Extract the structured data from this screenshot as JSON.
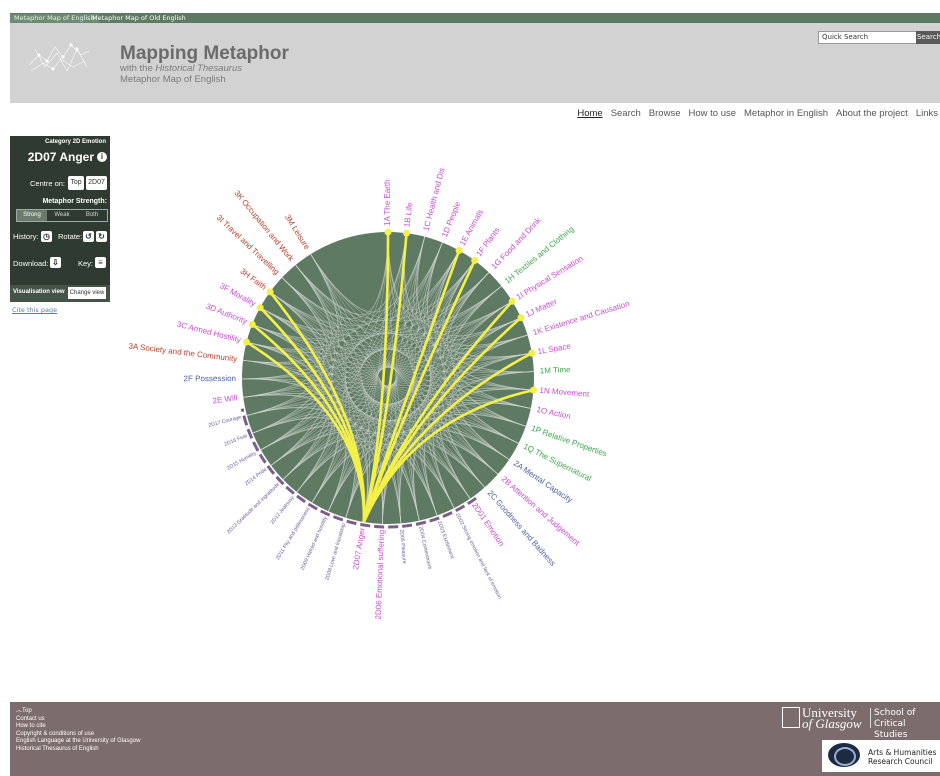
{
  "tabs": [
    "Metaphor Map of English",
    "Metaphor Map of Old English"
  ],
  "header": {
    "title": "Mapping Metaphor",
    "sub_prefix": "with the ",
    "sub_italic": "Historical Thesaurus",
    "sub2": "Metaphor Map of English",
    "search_placeholder": "Quick Search",
    "search_button": "Search"
  },
  "nav": [
    "Home",
    "Search",
    "Browse",
    "How to use",
    "Metaphor in English",
    "About the project",
    "Links"
  ],
  "panel": {
    "category": "Category 2D Emotion",
    "current": "2D07 Anger",
    "centre_on": "Centre on:",
    "centre_top": "Top",
    "centre_code": "2D07",
    "strength_label": "Metaphor Strength:",
    "strength_options": [
      "Strong",
      "Weak",
      "Both"
    ],
    "strength_selected": "Strong",
    "history": "History:",
    "rotate": "Rotate:",
    "download": "Download:",
    "key": "Key:",
    "vis_view": "Visualisation view",
    "change_view": "Change view"
  },
  "cite": "Cite this page",
  "colors": {
    "disc": "#5f7a63",
    "highlight": "#f4f04a",
    "magenta": "#c94bd1",
    "green": "#3ea84e",
    "red": "#b8402d",
    "purple": "#6b5a9c",
    "blue": "#4d62a8"
  },
  "viz": {
    "center_code": "2D07",
    "labels": [
      {
        "t": "1A The Earth",
        "c": "magenta",
        "yellow": true
      },
      {
        "t": "1B Life",
        "c": "magenta",
        "yellow": true
      },
      {
        "t": "1C Health and Dis",
        "c": "magenta",
        "yellow": false
      },
      {
        "t": "1D People",
        "c": "magenta",
        "yellow": false
      },
      {
        "t": "1E Animals",
        "c": "magenta",
        "yellow": true
      },
      {
        "t": "1F Plants",
        "c": "magenta",
        "yellow": true
      },
      {
        "t": "1G Food and Drink",
        "c": "magenta",
        "yellow": false
      },
      {
        "t": "1H Textiles and Clothing",
        "c": "green",
        "yellow": false
      },
      {
        "t": "1I Physical Sensation",
        "c": "magenta",
        "yellow": true
      },
      {
        "t": "1J Matter",
        "c": "magenta",
        "yellow": true
      },
      {
        "t": "1K Existence and Causation",
        "c": "magenta",
        "yellow": false
      },
      {
        "t": "1L Space",
        "c": "magenta",
        "yellow": true
      },
      {
        "t": "1M Time",
        "c": "green",
        "yellow": false
      },
      {
        "t": "1N Movement",
        "c": "magenta",
        "yellow": true
      },
      {
        "t": "1O Action",
        "c": "magenta",
        "yellow": false
      },
      {
        "t": "1P Relative Properties",
        "c": "green",
        "yellow": false
      },
      {
        "t": "1Q The Supernatural",
        "c": "green",
        "yellow": false
      },
      {
        "t": "2A Mental Capacity",
        "c": "blue",
        "yellow": false
      },
      {
        "t": "2B Attention and Judgement",
        "c": "magenta",
        "yellow": false
      },
      {
        "t": "2C Goodness and Badness",
        "c": "blue",
        "yellow": false
      },
      {
        "t": "2D01 Emotion",
        "c": "magenta",
        "yellow": false
      },
      {
        "t": "2D02 Strong emotion and lack of emotion",
        "c": "purple",
        "yellow": false
      },
      {
        "t": "2D03 Excitement",
        "c": "purple",
        "yellow": false
      },
      {
        "t": "2D04 Contentment",
        "c": "purple",
        "yellow": false
      },
      {
        "t": "2D05 Pleasure",
        "c": "purple",
        "yellow": false
      },
      {
        "t": "2D06 Emotional suffering",
        "c": "magenta",
        "yellow": false
      },
      {
        "t": "2D07 Anger",
        "c": "magenta",
        "yellow": false
      },
      {
        "t": "2D08 Love and friendship",
        "c": "purple",
        "yellow": false
      },
      {
        "t": "2D09 Hatred and hostility",
        "c": "purple",
        "yellow": false
      },
      {
        "t": "2D11 Pity and pitilessness",
        "c": "purple",
        "yellow": false
      },
      {
        "t": "2D12 Jealousy",
        "c": "purple",
        "yellow": false
      },
      {
        "t": "2D13 Gratitude and ingratitude",
        "c": "purple",
        "yellow": false
      },
      {
        "t": "2D14 Pride",
        "c": "purple",
        "yellow": false
      },
      {
        "t": "2D15 Humility",
        "c": "purple",
        "yellow": false
      },
      {
        "t": "2D16 Fear",
        "c": "purple",
        "yellow": false
      },
      {
        "t": "2D17 Courage",
        "c": "purple",
        "yellow": false
      },
      {
        "t": "2E Will",
        "c": "magenta",
        "yellow": false
      },
      {
        "t": "2F Possession",
        "c": "blue",
        "yellow": false
      },
      {
        "t": "3A Society and the Community",
        "c": "red",
        "yellow": false
      },
      {
        "t": "3C Armed Hostility",
        "c": "magenta",
        "yellow": true
      },
      {
        "t": "3D Authority",
        "c": "magenta",
        "yellow": true
      },
      {
        "t": "3F Morality",
        "c": "magenta",
        "yellow": true
      },
      {
        "t": "3H Faith",
        "c": "red",
        "yellow": true
      },
      {
        "t": "3I Travel and Travelling",
        "c": "red",
        "yellow": false
      },
      {
        "t": "3K Occupation and Work",
        "c": "red",
        "yellow": false
      },
      {
        "t": "3M Leisure",
        "c": "red",
        "yellow": false
      }
    ]
  },
  "footer": {
    "links": [
      "Top",
      "Contact us",
      "How to cite",
      "Copyright & conditions of use",
      "English Language at the University of Glasgow",
      "Historical Thesaurus of English"
    ],
    "uni1": "University",
    "uni2": "of Glasgow",
    "school1": "School of",
    "school2": "Critical Studies",
    "ahrc1": "Arts & Humanities",
    "ahrc2": "Research Council"
  }
}
